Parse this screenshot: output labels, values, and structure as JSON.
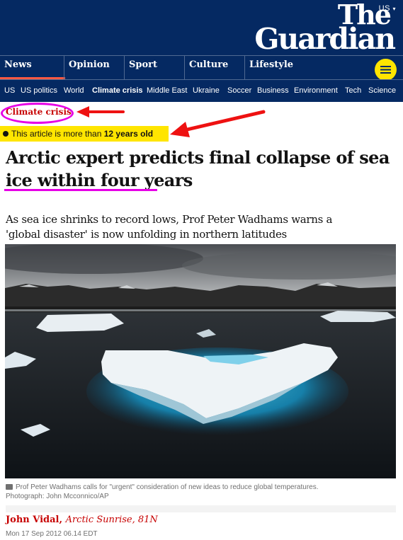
{
  "header": {
    "edition": "US",
    "logo_line1": "The",
    "logo_line2": "Guardian",
    "brand_color": "#052962",
    "accent_color": "#ffe500"
  },
  "pillars": [
    {
      "label": "News",
      "active": true
    },
    {
      "label": "Opinion"
    },
    {
      "label": "Sport"
    },
    {
      "label": "Culture"
    },
    {
      "label": "Lifestyle"
    }
  ],
  "subnav": [
    "US",
    "US politics",
    "World",
    "Climate crisis",
    "Middle East",
    "Ukraine",
    "Soccer",
    "Business",
    "Environment",
    "Tech",
    "Science"
  ],
  "article": {
    "kicker": "Climate crisis",
    "age_prefix": "This article is more than",
    "age_value": "12 years old",
    "headline": "Arctic expert predicts final collapse of sea ice within four years",
    "standfirst": "As sea ice shrinks to record lows, Prof Peter Wadhams warns a 'global disaster' is now unfolding in northern latitudes",
    "caption": "Prof Peter Wadhams calls for \"urgent\" consideration of new ideas to reduce global temperatures.",
    "credit": "Photograph: John Mcconnico/AP",
    "author": "John Vidal",
    "location": "Arctic Sunrise, 81N",
    "date": "Mon 17 Sep 2012 06.14 EDT"
  },
  "annotations": {
    "highlight_color": "#e600e6",
    "arrow_color": "#ee1111"
  }
}
